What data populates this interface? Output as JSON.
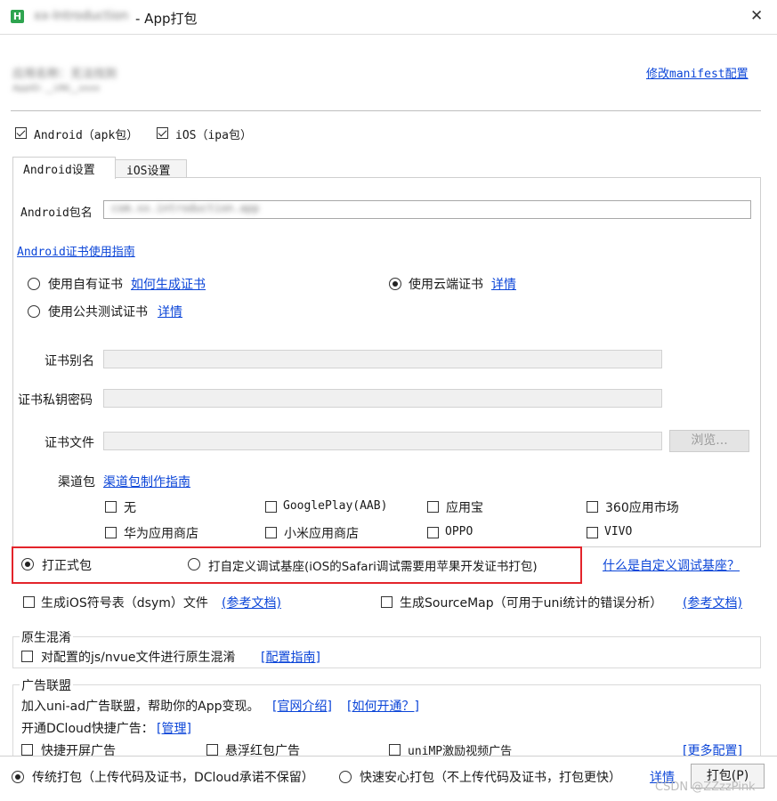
{
  "window": {
    "title_project": "xx-Introduction",
    "title_suffix": "- App打包",
    "close_symbol": "✕"
  },
  "header": {
    "app_name": "应用名称：无法找到",
    "app_id": "AppID: __UNI__xxxx",
    "modify_manifest": "修改manifest配置"
  },
  "platforms": {
    "android": {
      "label": "Android（apk包）",
      "checked": true
    },
    "ios": {
      "label": "iOS（ipa包）",
      "checked": true
    }
  },
  "tabs": [
    {
      "label": "Android设置",
      "active": true
    },
    {
      "label": "iOS设置",
      "active": false
    }
  ],
  "android": {
    "package_label": "Android包名",
    "package_value": "com.xx.introduction.app",
    "cert_guide": "Android证书使用指南",
    "cert_options": [
      {
        "label": "使用自有证书",
        "link": "如何生成证书",
        "checked": false
      },
      {
        "label": "使用云端证书",
        "link": "详情",
        "checked": true
      },
      {
        "label": "使用公共测试证书",
        "link": "详情",
        "checked": false
      }
    ],
    "alias_label": "证书别名",
    "password_label": "证书私钥密码",
    "file_label": "证书文件",
    "browse_button": "浏览...",
    "channel_label": "渠道包",
    "channel_link": "渠道包制作指南",
    "channels": [
      {
        "label": "无"
      },
      {
        "label": "GooglePlay(AAB)"
      },
      {
        "label": "应用宝"
      },
      {
        "label": "360应用市场"
      },
      {
        "label": "华为应用商店"
      },
      {
        "label": "小米应用商店"
      },
      {
        "label": "OPPO"
      },
      {
        "label": "VIVO"
      }
    ]
  },
  "package_type": {
    "formal": "打正式包",
    "custom_debug": "打自定义调试基座(iOS的Safari调试需要用苹果开发证书打包)",
    "what_is_link": "什么是自定义调试基座？",
    "highlight_color": "#e3242b"
  },
  "options": {
    "dsym_label": "生成iOS符号表（dsym）文件",
    "dsym_link": "(参考文档)",
    "sourcemap_label": "生成SourceMap（可用于uni统计的错误分析）",
    "sourcemap_link": "(参考文档)"
  },
  "obfuscation": {
    "section_title": "原生混淆",
    "label": "对配置的js/nvue文件进行原生混淆",
    "link": "[配置指南]"
  },
  "ads": {
    "section_title": "广告联盟",
    "intro": "加入uni-ad广告联盟，帮助你的App变现。",
    "intro_link": "[官网介绍]",
    "howto_link": "[如何开通？]",
    "dcloud_label": "开通DCloud快捷广告：",
    "manage_link": "[管理]",
    "items": [
      "快捷开屏广告",
      "悬浮红包广告",
      "uniMP激励视频广告"
    ],
    "more_link": "[更多配置]"
  },
  "footer": {
    "traditional": "传统打包（上传代码及证书，DCloud承诺不保留）",
    "fast": "快速安心打包（不上传代码及证书，打包更快）",
    "details_link": "详情",
    "build_button": "打包(P)",
    "watermark": "CSDN @ZZzzPink"
  }
}
